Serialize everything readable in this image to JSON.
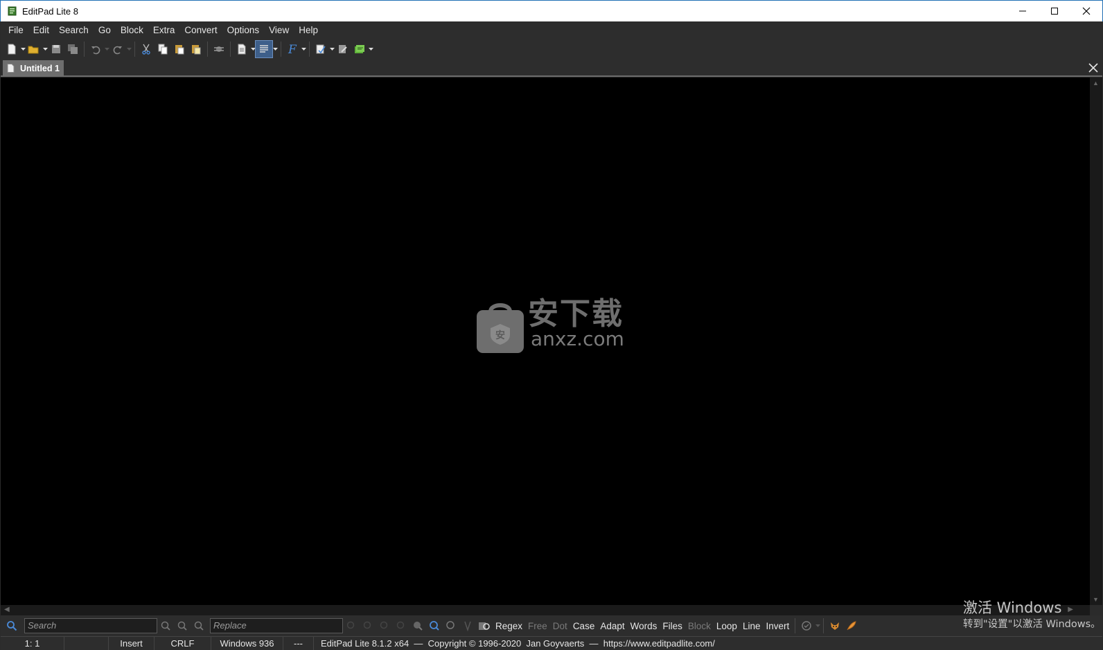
{
  "window": {
    "title": "EditPad Lite 8"
  },
  "menu": [
    {
      "label": "File"
    },
    {
      "label": "Edit"
    },
    {
      "label": "Search"
    },
    {
      "label": "Go"
    },
    {
      "label": "Block"
    },
    {
      "label": "Extra"
    },
    {
      "label": "Convert"
    },
    {
      "label": "Options"
    },
    {
      "label": "View"
    },
    {
      "label": "Help"
    }
  ],
  "tabs": [
    {
      "label": "Untitled 1"
    }
  ],
  "watermark": {
    "cn": "安下载",
    "en": "anxz.com"
  },
  "search": {
    "search_placeholder": "Search",
    "replace_placeholder": "Replace",
    "options": [
      {
        "label": "Regex",
        "enabled": true
      },
      {
        "label": "Free",
        "enabled": false
      },
      {
        "label": "Dot",
        "enabled": false
      },
      {
        "label": "Case",
        "enabled": true
      },
      {
        "label": "Adapt",
        "enabled": true
      },
      {
        "label": "Words",
        "enabled": true
      },
      {
        "label": "Files",
        "enabled": true
      },
      {
        "label": "Block",
        "enabled": false
      },
      {
        "label": "Loop",
        "enabled": true
      },
      {
        "label": "Line",
        "enabled": true
      },
      {
        "label": "Invert",
        "enabled": true
      }
    ]
  },
  "activation": {
    "line1": "激活 Windows",
    "line2": "转到\"设置\"以激活 Windows。"
  },
  "status": {
    "position": "1: 1",
    "blank": "",
    "mode": "Insert",
    "line_break": "CRLF",
    "encoding": "Windows 936",
    "dashes": "---",
    "info": "EditPad Lite 8.1.2 x64  —  Copyright © 1996-2020  Jan Goyvaerts  —  https://www.editpadlite.com/"
  },
  "colors": {
    "editor_bg": "#000000",
    "chrome_bg": "#2d2d2d",
    "title_border": "#1f6fb5"
  }
}
